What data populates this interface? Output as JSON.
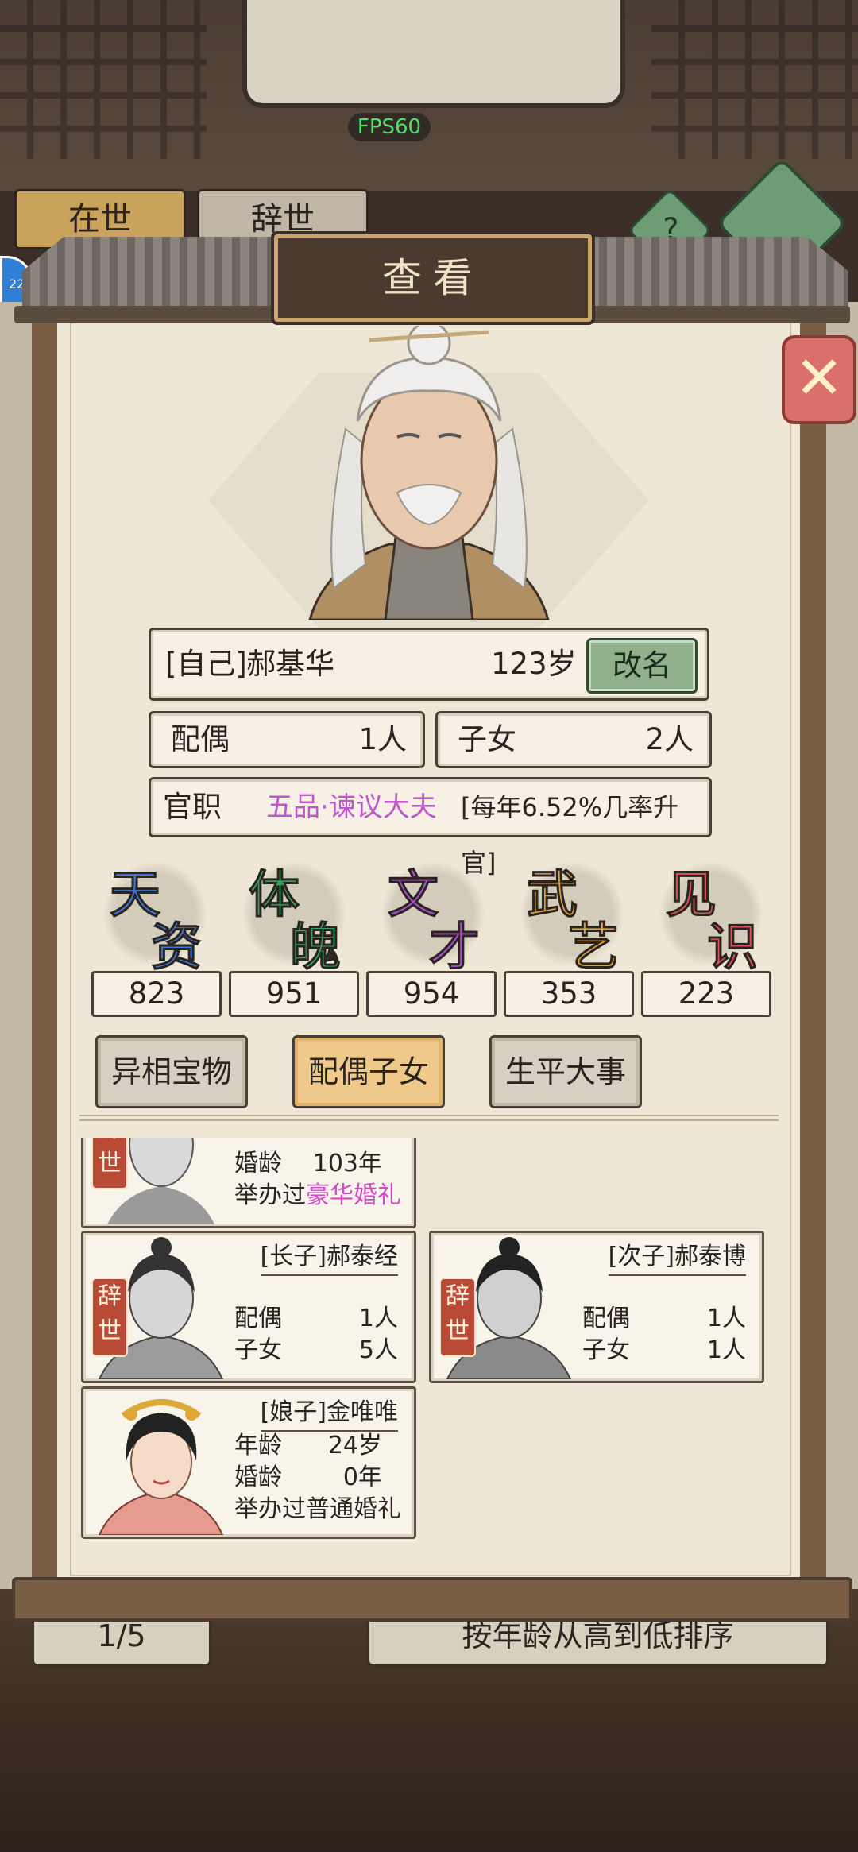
{
  "hud": {
    "fps": "FPS60",
    "badge": "22"
  },
  "background": {
    "tab_alive": "在世",
    "tab_deceased": "辞世",
    "help_icon": "?",
    "pager": "1/5",
    "sort_label": "按年龄从高到低排序"
  },
  "dialog": {
    "title": "查看",
    "close_icon": "✕"
  },
  "character": {
    "relation": "[自己]",
    "name": "郝基华",
    "age": "123岁",
    "rename_label": "改名",
    "spouse_label": "配偶",
    "spouse_value": "1人",
    "children_label": "子女",
    "children_value": "2人",
    "office_label": "官职",
    "office_title": "五品·谏议大夫",
    "office_note": "[每年6.52%几率升官]"
  },
  "stats": [
    {
      "c1": "天",
      "c2": "资",
      "color": "#3f78d8",
      "value": "823"
    },
    {
      "c1": "体",
      "c2": "魄",
      "color": "#2fa65a",
      "value": "951"
    },
    {
      "c1": "文",
      "c2": "才",
      "color": "#a84fd0",
      "value": "954"
    },
    {
      "c1": "武",
      "c2": "艺",
      "color": "#e0a43a",
      "value": "353"
    },
    {
      "c1": "见",
      "c2": "识",
      "color": "#e0505a",
      "value": "223"
    }
  ],
  "tabs": {
    "treasure": "异相宝物",
    "family": "配偶子女",
    "events": "生平大事"
  },
  "family": {
    "deceased_tag": "辞世",
    "card0": {
      "marriage_label": "婚龄",
      "marriage_value": "103年",
      "wedding_prefix": "举办过",
      "wedding_type": "豪华婚礼"
    },
    "card1": {
      "relation": "[长子]",
      "name": "郝泰经",
      "spouse_label": "配偶",
      "spouse_value": "1人",
      "children_label": "子女",
      "children_value": "5人"
    },
    "card2": {
      "relation": "[次子]",
      "name": "郝泰博",
      "spouse_label": "配偶",
      "spouse_value": "1人",
      "children_label": "子女",
      "children_value": "1人"
    },
    "card3": {
      "relation": "[娘子]",
      "name": "金唯唯",
      "age_label": "年龄",
      "age_value": "24岁",
      "marriage_label": "婚龄",
      "marriage_value": "0年",
      "wedding_prefix": "举办过",
      "wedding_type": "普通婚礼"
    }
  }
}
